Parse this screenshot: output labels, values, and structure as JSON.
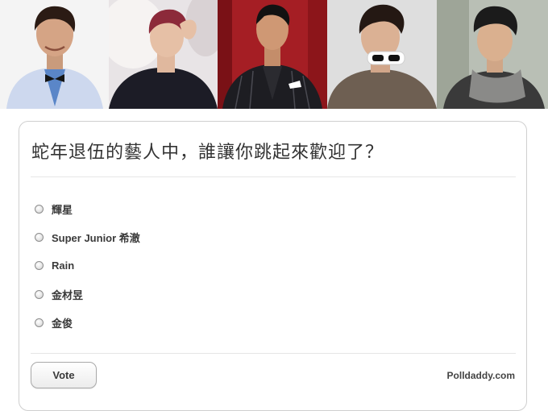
{
  "banner": {
    "photos": [
      {
        "name": "light-suit-bow-tie",
        "bg": "#f3f3f3",
        "outfit": "#cfdaf0",
        "hair": "#2b1b14"
      },
      {
        "name": "red-hair-dark-shirt",
        "bg": "#e8e4e6",
        "outfit": "#1c1c26",
        "hair": "#8c2a3a"
      },
      {
        "name": "pinstripe-jacket",
        "bg": "#a51e24",
        "outfit": "#1d1d22",
        "hair": "#121212"
      },
      {
        "name": "white-sunglasses",
        "bg": "#dcdcdc",
        "outfit": "#6e5f52",
        "hair": "#241813"
      },
      {
        "name": "knit-beanie-scarf",
        "bg": "#b9bfb5",
        "outfit": "#3a3a3a",
        "hair": "#1b1b1b"
      }
    ]
  },
  "poll": {
    "question": "蛇年退伍的藝人中，誰讓你跳起來歡迎了？",
    "options": [
      {
        "label": "輝星"
      },
      {
        "label": "Super Junior 希澈"
      },
      {
        "label": "Rain"
      },
      {
        "label": "金材昱"
      },
      {
        "label": "金俊"
      }
    ],
    "vote_label": "Vote",
    "credit": "Polldaddy.com"
  }
}
